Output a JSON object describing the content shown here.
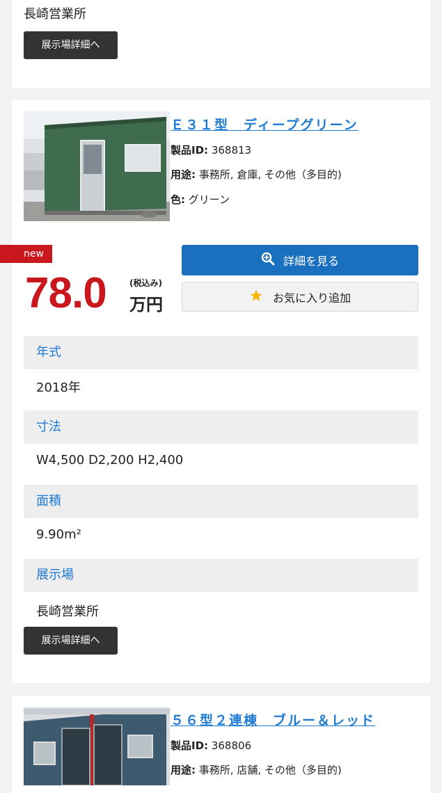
{
  "top_card": {
    "location": "長崎営業所",
    "showroom_button": "展示場詳細へ"
  },
  "listing": {
    "title": "Ｅ３１型　ディープグリーン",
    "product_id_label": "製品ID:",
    "product_id": "368813",
    "use_label": "用途:",
    "use": "事務所, 倉庫, その他（多目的)",
    "color_label": "色:",
    "color": "グリーン",
    "badge": "new",
    "price": "78.0",
    "tax_note": "(税込み)",
    "unit": "万円",
    "detail_button": "詳細を見る",
    "favorite_button": "お気に入り追加",
    "specs": [
      {
        "label": "年式",
        "value": "2018年"
      },
      {
        "label": "寸法",
        "value": "W4,500 D2,200 H2,400"
      },
      {
        "label": "面積",
        "value": "9.90m²"
      },
      {
        "label": "展示場",
        "value": "長崎営業所"
      }
    ],
    "showroom_button": "展示場詳細へ"
  },
  "next_listing": {
    "title": "５６型２連棟　ブルー＆レッド",
    "product_id_label": "製品ID:",
    "product_id": "368806",
    "use_label": "用途:",
    "use": "事務所, 店舗, その他（多目的)"
  },
  "colors": {
    "accent_blue": "#1a6fbf",
    "link_blue": "#1f7ad1",
    "price_red": "#c8171d"
  }
}
